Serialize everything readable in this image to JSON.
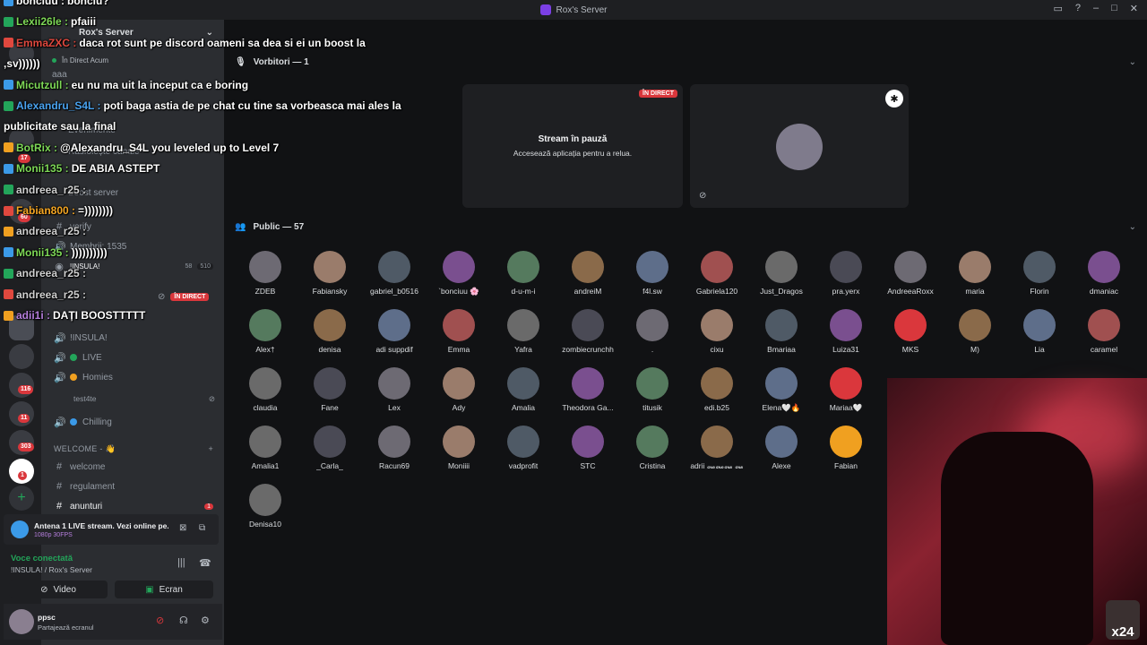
{
  "window": {
    "title": "Rox's Server"
  },
  "sidebar": {
    "server_name": "Rox's Server",
    "live_label": "În Direct Acum",
    "partial_channels": [
      {
        "label": "aaa"
      },
      {
        "label": "Evenimente"
      },
      {
        "label": "Răsfoiește canale"
      },
      {
        "label": "Boost server"
      },
      {
        "label": "verify"
      },
      {
        "label": "Membrii: 1535"
      },
      {
        "label": "!INSULA!"
      }
    ],
    "insula_stats": {
      "viewers": "58",
      "limit": "510"
    },
    "live_badge": "ÎN DIRECT",
    "channels": [
      {
        "label": "!INSULA!"
      },
      {
        "label": "LIVE"
      },
      {
        "label": "Homies"
      },
      {
        "label": "test4te"
      },
      {
        "label": "Chilling"
      }
    ],
    "category": "WELCOME - 👋",
    "text_channels": [
      {
        "label": "welcome"
      },
      {
        "label": "regulament"
      },
      {
        "label": "anunturi",
        "badge": "1"
      }
    ],
    "server_badges": [
      "17",
      "60",
      "116",
      "11",
      "303",
      "1"
    ]
  },
  "activity": {
    "title": "Antena 1 LIVE stream. Vezi online pe...",
    "quality": "1080p 30FPS"
  },
  "voice": {
    "status": "Voce conectată",
    "location": "!INSULA! / Rox's Server",
    "video_label": "Video",
    "screen_label": "Ecran"
  },
  "user": {
    "name": "ppsc",
    "status": "Partajează ecranul"
  },
  "stage": {
    "speakers_label": "Vorbitori — 1",
    "stream_paused_title": "Stream în pauză",
    "stream_paused_sub": "Accesează aplicația pentru a relua.",
    "stream_live_badge": "ÎN DIRECT",
    "public_label": "Public — 57"
  },
  "audience": [
    "ZDEB",
    "Fabiansky",
    "gabriel_b0516",
    "`bonciuu 🌸",
    "d-u-m-i",
    "andreiM",
    "f4l.sw",
    "Gabriela120",
    "Just_Dragos",
    "pra.yerx",
    "AndreeaRoxx",
    "maria",
    "Florin",
    "dmaniac",
    "Alex†",
    "denisa",
    "adi suppdif",
    "Emma",
    "Yafra",
    "zombiecrunchh",
    ".",
    "cixu",
    "Bmariaa",
    "Luiza31",
    "MKS",
    "M)",
    "Lia",
    "caramel",
    "claudia",
    "Fane",
    "Lex",
    "Ady",
    "Amalia",
    "Theodora Ga...",
    "titusik",
    "edi.b25",
    "Elena🤍🔥",
    "Mariaa🤍",
    "Amalia1",
    "_Carla_",
    "Racun69",
    "Moniiii",
    "vadprofit",
    "STC",
    "Cristina",
    "adrii ꘏꘏꘏ ꘏",
    "Alexe",
    "Fabian",
    "Denisa10"
  ],
  "chat": [
    {
      "user": "bonciuu",
      "text": "bonciu?",
      "color": "#ffffff"
    },
    {
      "user": "Lexii26le",
      "text": "pfaiii",
      "color": "#7ed957"
    },
    {
      "user": "EmmaZXC",
      "text": "daca rot sunt pe discord oameni sa dea si ei un boost la",
      "color": "#e0483e"
    },
    {
      "user": "",
      "text": ",sv))))))",
      "color": "#ffffff"
    },
    {
      "user": "Micutzull",
      "text": "eu nu ma uit la inceput ca e boring",
      "color": "#7ed957"
    },
    {
      "user": "Alexandru_S4L",
      "text": "poti baga astia de pe chat cu tine sa vorbeasca mai ales la",
      "color": "#4aa3f0"
    },
    {
      "user": "",
      "text": "publicitate sau la final",
      "color": "#ffffff"
    },
    {
      "user": "BotRix",
      "text": "@Alexandru_S4L you leveled up to Level 7",
      "color": "#7ed957"
    },
    {
      "user": "Monii135",
      "text": "DE ABIA ASTEPT",
      "color": "#7ed957"
    },
    {
      "user": "andreea_r25",
      "text": "",
      "color": "#d0d0d0"
    },
    {
      "user": "Fabian800",
      "text": "=))))))))",
      "color": "#f5a623"
    },
    {
      "user": "andreea_r25",
      "text": "",
      "color": "#d0d0d0"
    },
    {
      "user": "Monii135",
      "text": "))))))))))",
      "color": "#7ed957"
    },
    {
      "user": "andreea_r25",
      "text": "",
      "color": "#d0d0d0"
    },
    {
      "user": "andreea_r25",
      "text": "",
      "color": "#d0d0d0"
    },
    {
      "user": "adii1i",
      "text": "DAȚI BOOSTTTTT",
      "color": "#b57edc"
    }
  ],
  "cam_watermark": "x24",
  "colors": {
    "accent": "#5865f2",
    "live": "#da373c",
    "online": "#23a55a"
  }
}
